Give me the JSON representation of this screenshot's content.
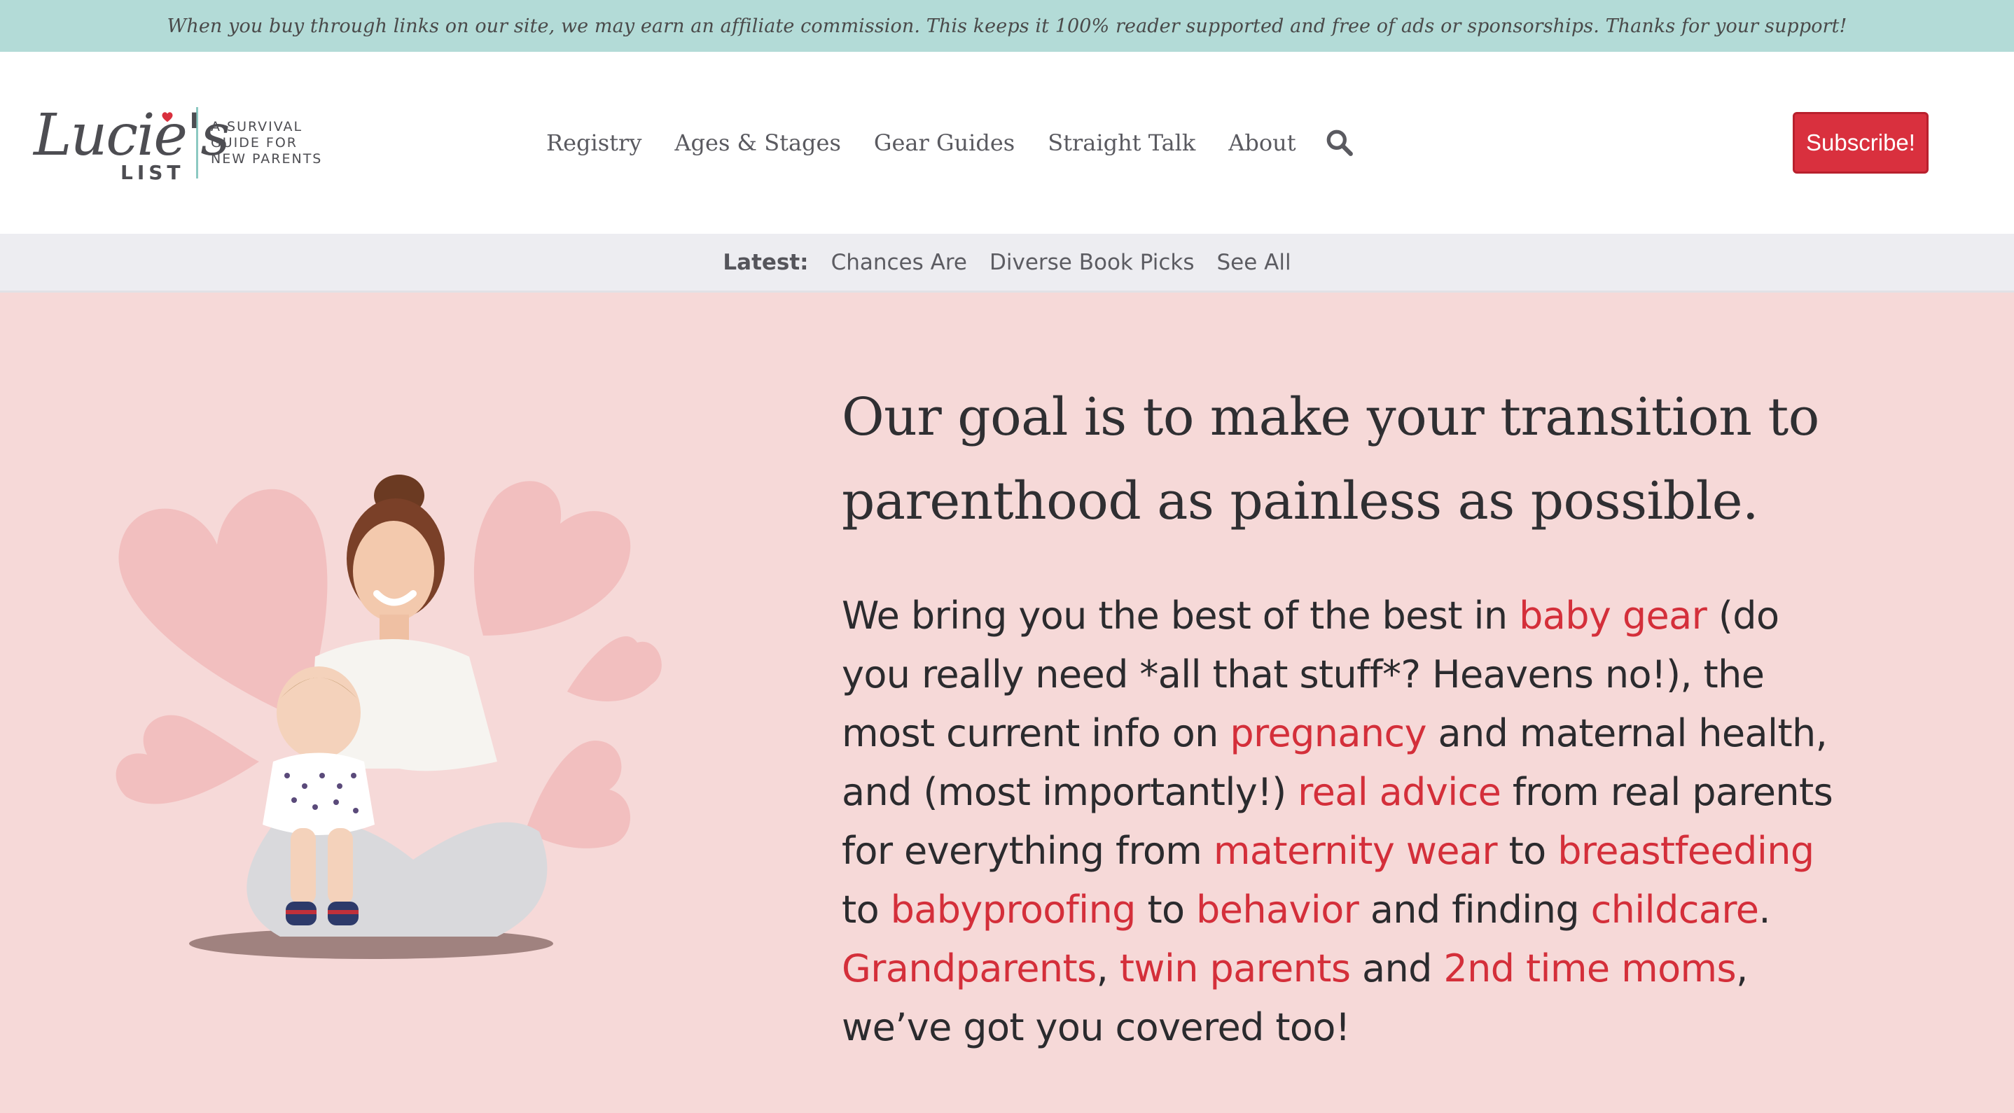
{
  "affiliate_notice": "When you buy through links on our site, we may earn an affiliate commission. This keeps it 100% reader supported and free of ads or sponsorships. Thanks for your support!",
  "logo": {
    "script": "Lucie's",
    "wordmark": "LIST",
    "tagline": [
      "A SURVIVAL",
      "GUIDE FOR",
      "NEW PARENTS"
    ]
  },
  "nav": {
    "items": [
      "Registry",
      "Ages & Stages",
      "Gear Guides",
      "Straight Talk",
      "About"
    ],
    "search_icon": "search-icon"
  },
  "subscribe_label": "Subscribe!",
  "latest": {
    "label": "Latest:",
    "links": [
      "Chances Are",
      "Diverse Book Picks",
      "See All"
    ]
  },
  "hero": {
    "heading": "Our goal is to make your transition to parenthood as painless as possible.",
    "body": {
      "t0": "We bring you the best of the best in ",
      "l_baby_gear": "baby gear",
      "t1": " (do you really need *all that stuff*? Heavens no!), the most current info on ",
      "l_pregnancy": "pregnancy",
      "t2": " and maternal health, and (most importantly!) ",
      "l_real_advice": "real advice",
      "t3": " from real parents for everything from ",
      "l_maternity_wear": "maternity wear",
      "t4": " to ",
      "l_breastfeeding": "breastfeeding",
      "t5": " to ",
      "l_babyproofing": "babyproofing",
      "t6": " to ",
      "l_behavior": "behavior",
      "t7": " and finding ",
      "l_childcare": "childcare",
      "t8": ". ",
      "l_grandparents": "Grandparents",
      "t9": ", ",
      "l_twin_parents": "twin parents",
      "t10": " and ",
      "l_2nd_time_moms": "2nd time moms",
      "t11": ", we’ve got you covered too!"
    }
  },
  "colors": {
    "affiliate_bg": "#b3dbd7",
    "hero_bg": "#f6d9d8",
    "accent_red": "#d42f3a",
    "latest_bg": "#ededf1"
  }
}
